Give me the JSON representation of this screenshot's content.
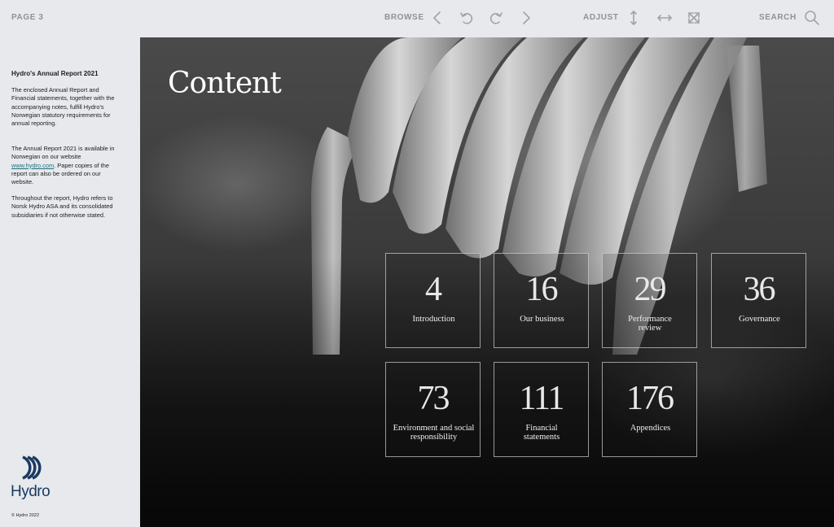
{
  "toolbar": {
    "page_label": "PAGE 3",
    "browse_label": "BROWSE",
    "adjust_label": "ADJUST",
    "search_label": "SEARCH"
  },
  "sidebar": {
    "title": "Hydro's Annual Report 2021",
    "para1": "The enclosed Annual Report and Financial statements, together with the accompanying notes, fulfill Hydro's Norwegian statutory requirements for annual reporting.",
    "para2_before": "The Annual Report 2021 is available in Norwegian on our website ",
    "para2_link": "www.hydro.com",
    "para2_after": ". Paper copies of the report can also be ordered on our website.",
    "para3": "Throughout the report, Hydro refers to Norsk Hydro ASA and its consolidated subsidiaries if not otherwise stated.",
    "logo_text": "Hydro",
    "copyright": "© Hydro 2022"
  },
  "main": {
    "title": "Content",
    "tiles": [
      {
        "number": "4",
        "label": "Introduction"
      },
      {
        "number": "16",
        "label": "Our business"
      },
      {
        "number": "29",
        "label": "Performance review"
      },
      {
        "number": "36",
        "label": "Governance"
      },
      {
        "number": "73",
        "label": "Environment and social responsibility"
      },
      {
        "number": "111",
        "label": "Financial statements"
      },
      {
        "number": "176",
        "label": "Appendices"
      }
    ]
  },
  "colors": {
    "background": "#e7e9ec",
    "logo_blue": "#1b3a61",
    "link": "#1a6f7e",
    "toolbar_text": "#8f9296"
  }
}
